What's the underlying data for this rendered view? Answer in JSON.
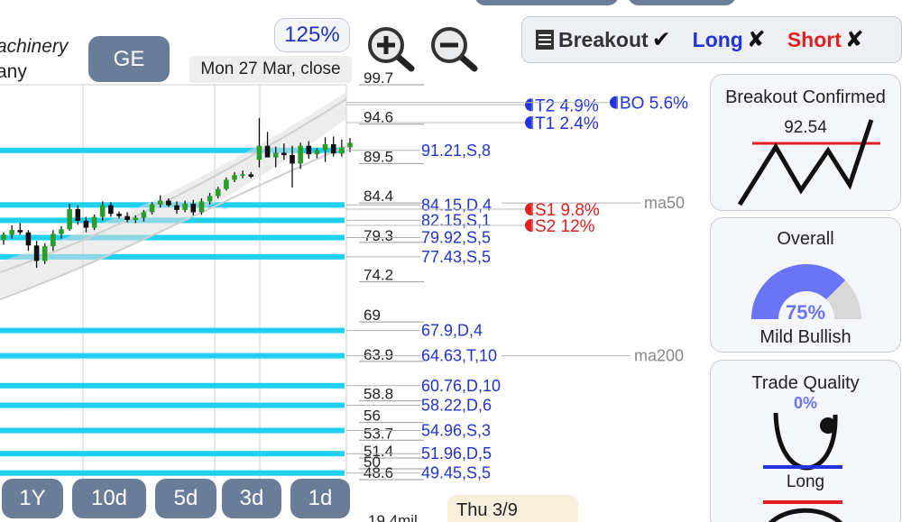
{
  "company": {
    "line1": "achinery",
    "line2": "any"
  },
  "ticker": "GE",
  "zoom_level": "125%",
  "date_label": "Mon 27 Mar, close",
  "filters": [
    {
      "label": "Breakout",
      "mark": "✔",
      "color": "#333333",
      "icon": "list-icon",
      "mark_icon": "check-icon"
    },
    {
      "label": "Long",
      "mark": "✘",
      "color": "#2233dd",
      "mark_icon": "cross-icon"
    },
    {
      "label": "Short",
      "mark": "✘",
      "color": "#e02020",
      "mark_icon": "cross-icon"
    }
  ],
  "periods": [
    "1Y",
    "10d",
    "5d",
    "3d",
    "1d"
  ],
  "date_flag": "Thu 3/9",
  "volume_label": "19.4mil",
  "chart_data": {
    "type": "candlestick",
    "ylim": [
      45.5,
      102
    ],
    "y_ticks": [
      {
        "value": 99.7,
        "label": "99.7"
      },
      {
        "value": 94.6,
        "label": "94.6"
      },
      {
        "value": 89.5,
        "label": "89.5"
      },
      {
        "value": 84.4,
        "label": "84.4"
      },
      {
        "value": 79.3,
        "label": "79.3"
      },
      {
        "value": 74.2,
        "label": "74.2"
      },
      {
        "value": 69,
        "label": "69"
      },
      {
        "value": 63.9,
        "label": "63.9"
      },
      {
        "value": 58.8,
        "label": "58.8"
      },
      {
        "value": 56,
        "label": "56"
      },
      {
        "value": 53.7,
        "label": "53.7"
      },
      {
        "value": 51.4,
        "label": "51.4"
      },
      {
        "value": 50,
        "label": "50"
      },
      {
        "value": 48.6,
        "label": "48.6"
      }
    ],
    "levels": [
      {
        "value": 91.21,
        "label": "91.21,S,8"
      },
      {
        "value": 84.15,
        "label": "84.15,D,4"
      },
      {
        "value": 82.15,
        "label": "82.15,S,1"
      },
      {
        "value": 79.92,
        "label": "79.92,S,5"
      },
      {
        "value": 77.43,
        "label": "77.43,S,5"
      },
      {
        "value": 67.9,
        "label": "67.9,D,4"
      },
      {
        "value": 64.63,
        "label": "64.63,T,10"
      },
      {
        "value": 60.76,
        "label": "60.76,D,10"
      },
      {
        "value": 58.22,
        "label": "58.22,D,6"
      },
      {
        "value": 54.96,
        "label": "54.96,S,3"
      },
      {
        "value": 51.96,
        "label": "51.96,D,5"
      },
      {
        "value": 49.45,
        "label": "49.45,S,5"
      }
    ],
    "targets": [
      {
        "value": 97.1,
        "label": "T2 4.9%",
        "color": "#2233dd"
      },
      {
        "value": 94.8,
        "label": "T1 2.4%",
        "color": "#2233dd"
      },
      {
        "value": 83.6,
        "label": "S1 9.8%",
        "color": "#dd2020"
      },
      {
        "value": 81.5,
        "label": "S2 12%",
        "color": "#dd2020"
      }
    ],
    "breakout": {
      "value": 97.4,
      "label": "BO 5.6%",
      "color": "#2233dd"
    },
    "moving_averages": [
      {
        "name": "ma50",
        "value": 84.4
      },
      {
        "name": "ma200",
        "value": 64.63
      }
    ],
    "candles": [
      {
        "o": 79.6,
        "h": 80.6,
        "l": 79.0,
        "c": 80.3
      },
      {
        "o": 80.3,
        "h": 81.5,
        "l": 79.8,
        "c": 80.9
      },
      {
        "o": 80.9,
        "h": 81.8,
        "l": 80.3,
        "c": 80.6
      },
      {
        "o": 80.6,
        "h": 80.9,
        "l": 78.2,
        "c": 78.9
      },
      {
        "o": 78.9,
        "h": 79.5,
        "l": 76.0,
        "c": 76.9
      },
      {
        "o": 76.9,
        "h": 79.2,
        "l": 76.5,
        "c": 78.8
      },
      {
        "o": 78.8,
        "h": 80.9,
        "l": 78.2,
        "c": 80.4
      },
      {
        "o": 80.4,
        "h": 81.4,
        "l": 79.8,
        "c": 81.0
      },
      {
        "o": 81.0,
        "h": 84.3,
        "l": 80.8,
        "c": 83.6
      },
      {
        "o": 83.6,
        "h": 84.1,
        "l": 81.6,
        "c": 82.1
      },
      {
        "o": 82.1,
        "h": 82.6,
        "l": 80.6,
        "c": 81.2
      },
      {
        "o": 81.2,
        "h": 82.9,
        "l": 80.9,
        "c": 82.6
      },
      {
        "o": 82.6,
        "h": 84.6,
        "l": 82.1,
        "c": 84.1
      },
      {
        "o": 84.1,
        "h": 84.5,
        "l": 82.6,
        "c": 83.0
      },
      {
        "o": 83.0,
        "h": 83.3,
        "l": 82.4,
        "c": 82.7
      },
      {
        "o": 82.7,
        "h": 83.2,
        "l": 81.9,
        "c": 82.2
      },
      {
        "o": 82.2,
        "h": 82.8,
        "l": 81.8,
        "c": 82.5
      },
      {
        "o": 82.5,
        "h": 83.5,
        "l": 82.0,
        "c": 83.2
      },
      {
        "o": 83.2,
        "h": 84.5,
        "l": 82.9,
        "c": 84.2
      },
      {
        "o": 84.2,
        "h": 85.4,
        "l": 83.8,
        "c": 84.7
      },
      {
        "o": 84.7,
        "h": 85.0,
        "l": 83.9,
        "c": 84.1
      },
      {
        "o": 84.1,
        "h": 84.6,
        "l": 83.0,
        "c": 83.5
      },
      {
        "o": 83.5,
        "h": 84.7,
        "l": 83.2,
        "c": 84.3
      },
      {
        "o": 84.3,
        "h": 84.8,
        "l": 82.8,
        "c": 83.2
      },
      {
        "o": 83.2,
        "h": 85.0,
        "l": 82.9,
        "c": 84.6
      },
      {
        "o": 84.6,
        "h": 85.7,
        "l": 84.2,
        "c": 85.3
      },
      {
        "o": 85.3,
        "h": 86.5,
        "l": 85.0,
        "c": 86.2
      },
      {
        "o": 86.2,
        "h": 87.7,
        "l": 86.0,
        "c": 87.4
      },
      {
        "o": 87.4,
        "h": 88.4,
        "l": 87.1,
        "c": 88.0
      },
      {
        "o": 88.0,
        "h": 88.6,
        "l": 87.6,
        "c": 88.1
      },
      {
        "o": 88.1,
        "h": 88.4,
        "l": 87.6,
        "c": 87.8
      },
      {
        "o": 90.0,
        "h": 95.4,
        "l": 89.0,
        "c": 91.8
      },
      {
        "o": 91.8,
        "h": 93.6,
        "l": 90.8,
        "c": 90.3
      },
      {
        "o": 90.3,
        "h": 91.7,
        "l": 89.0,
        "c": 90.9
      },
      {
        "o": 90.9,
        "h": 92.1,
        "l": 90.0,
        "c": 90.6
      },
      {
        "o": 90.6,
        "h": 91.8,
        "l": 86.4,
        "c": 89.5
      },
      {
        "o": 89.5,
        "h": 92.2,
        "l": 88.8,
        "c": 91.8
      },
      {
        "o": 91.8,
        "h": 92.4,
        "l": 90.1,
        "c": 90.7
      },
      {
        "o": 90.7,
        "h": 91.5,
        "l": 90.2,
        "c": 91.2
      },
      {
        "o": 91.2,
        "h": 92.9,
        "l": 89.7,
        "c": 92.0
      },
      {
        "o": 92.0,
        "h": 93.0,
        "l": 90.4,
        "c": 90.8
      },
      {
        "o": 90.8,
        "h": 92.6,
        "l": 90.4,
        "c": 91.6
      },
      {
        "o": 91.6,
        "h": 92.8,
        "l": 91.0,
        "c": 92.2
      }
    ]
  },
  "cards": {
    "breakout": {
      "title": "Breakout Confirmed",
      "price": "92.54"
    },
    "overall": {
      "title": "Overall",
      "percent": "75%",
      "value": 0.75,
      "label": "Mild Bullish"
    },
    "quality": {
      "title": "Trade Quality",
      "percent": "0%",
      "label": "Long"
    }
  },
  "colors": {
    "level_band": "#1fd0f0",
    "level_text": "#2233cc",
    "up_candle": "#2a9d2a",
    "down_candle": "#111111",
    "button": "#6a7d98",
    "gauge_fill": "#6a74f4",
    "gauge_track": "#d8d8d8"
  }
}
